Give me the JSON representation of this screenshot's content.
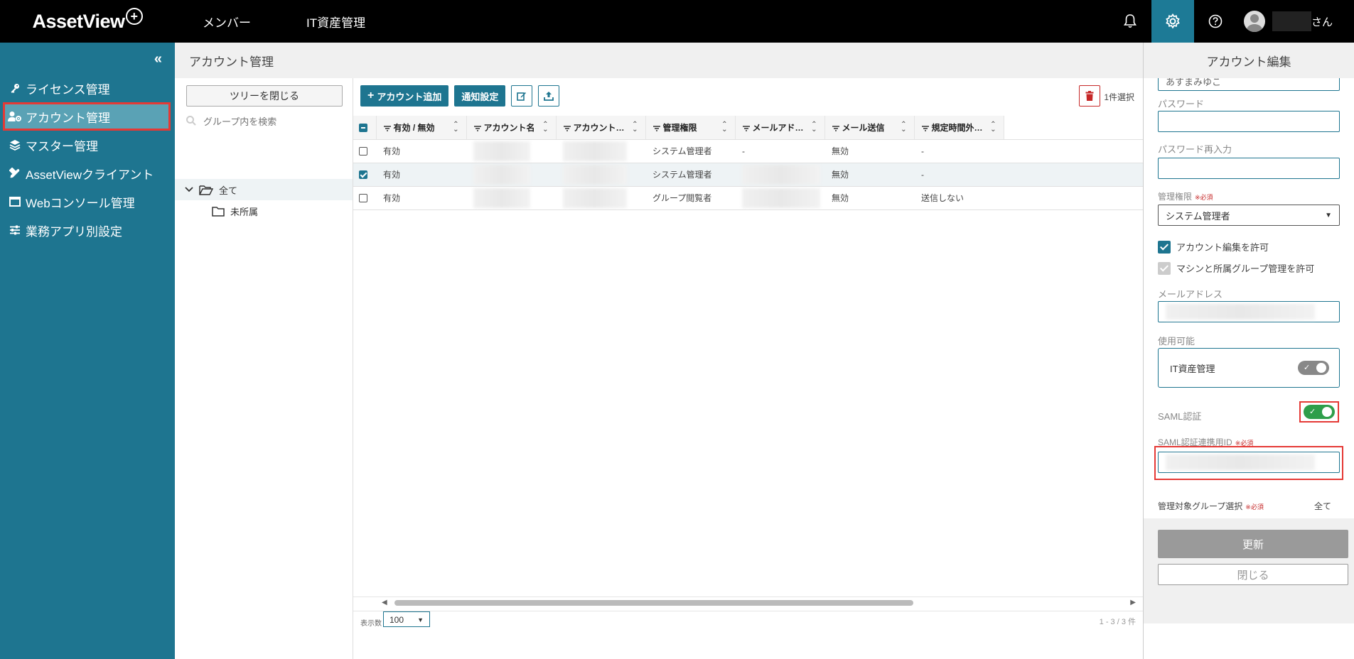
{
  "brand": {
    "logo_text": "AssetView",
    "logo_symbol": "+"
  },
  "topnav": {
    "items": [
      "メンバー",
      "IT資産管理"
    ]
  },
  "topright": {
    "bell_icon": "bell-icon",
    "settings_icon": "gear-icon",
    "help_icon": "question-icon",
    "username_suffix": "さん"
  },
  "sidebar": {
    "collapse_icon": "«",
    "items": [
      {
        "label": "ライセンス管理",
        "icon": "key-icon"
      },
      {
        "label": "アカウント管理",
        "icon": "user-gear-icon",
        "active": true
      },
      {
        "label": "マスター管理",
        "icon": "layers-icon"
      },
      {
        "label": "AssetViewクライアント",
        "icon": "tools-icon"
      },
      {
        "label": "Webコンソール管理",
        "icon": "window-icon"
      },
      {
        "label": "業務アプリ別設定",
        "icon": "sliders-icon"
      }
    ]
  },
  "main": {
    "title": "アカウント管理"
  },
  "tree": {
    "close_button": "ツリーを閉じる",
    "search_placeholder": "グループ内を検索",
    "root_label": "全て",
    "child_label": "未所属"
  },
  "toolbar": {
    "add_account": "アカウント追加",
    "notify_settings": "通知設定",
    "selected_count": "1件選択"
  },
  "grid": {
    "columns": [
      "有効 / 無効",
      "アカウント名",
      "アカウント…",
      "管理権限",
      "メールアド…",
      "メール送信",
      "規定時間外…"
    ],
    "rows": [
      {
        "checked": false,
        "enabled": "有効",
        "role": "システム管理者",
        "email": "-",
        "send": "無効",
        "outside": "-"
      },
      {
        "checked": true,
        "enabled": "有効",
        "role": "システム管理者",
        "email": "",
        "send": "無効",
        "outside": "-"
      },
      {
        "checked": false,
        "enabled": "有効",
        "role": "グループ閲覧者",
        "email": "",
        "send": "無効",
        "outside": "送信しない"
      }
    ],
    "page_size_label": "表示数",
    "page_size": "100",
    "page_info": "1 - 3 / 3 件"
  },
  "panel": {
    "title": "アカウント編集",
    "top_input_value": "あすまみゆこ",
    "password_label": "パスワード",
    "password_confirm_label": "パスワード再入力",
    "role_label": "管理権限",
    "required_mark": "※必須",
    "role_value": "システム管理者",
    "allow_edit_label": "アカウント編集を許可",
    "allow_machine_label": "マシンと所属グループ管理を許可",
    "email_label": "メールアドレス",
    "usable_label": "使用可能",
    "it_asset_label": "IT資産管理",
    "saml_label": "SAML認証",
    "saml_id_label": "SAML認証連携用ID",
    "group_select_label": "管理対象グループ選択",
    "group_select_value": "全て",
    "update_button": "更新",
    "close_button": "閉じる"
  },
  "colors": {
    "accent": "#1e7590",
    "highlight": "#e53935",
    "toggle_on": "#2e9e4a"
  }
}
